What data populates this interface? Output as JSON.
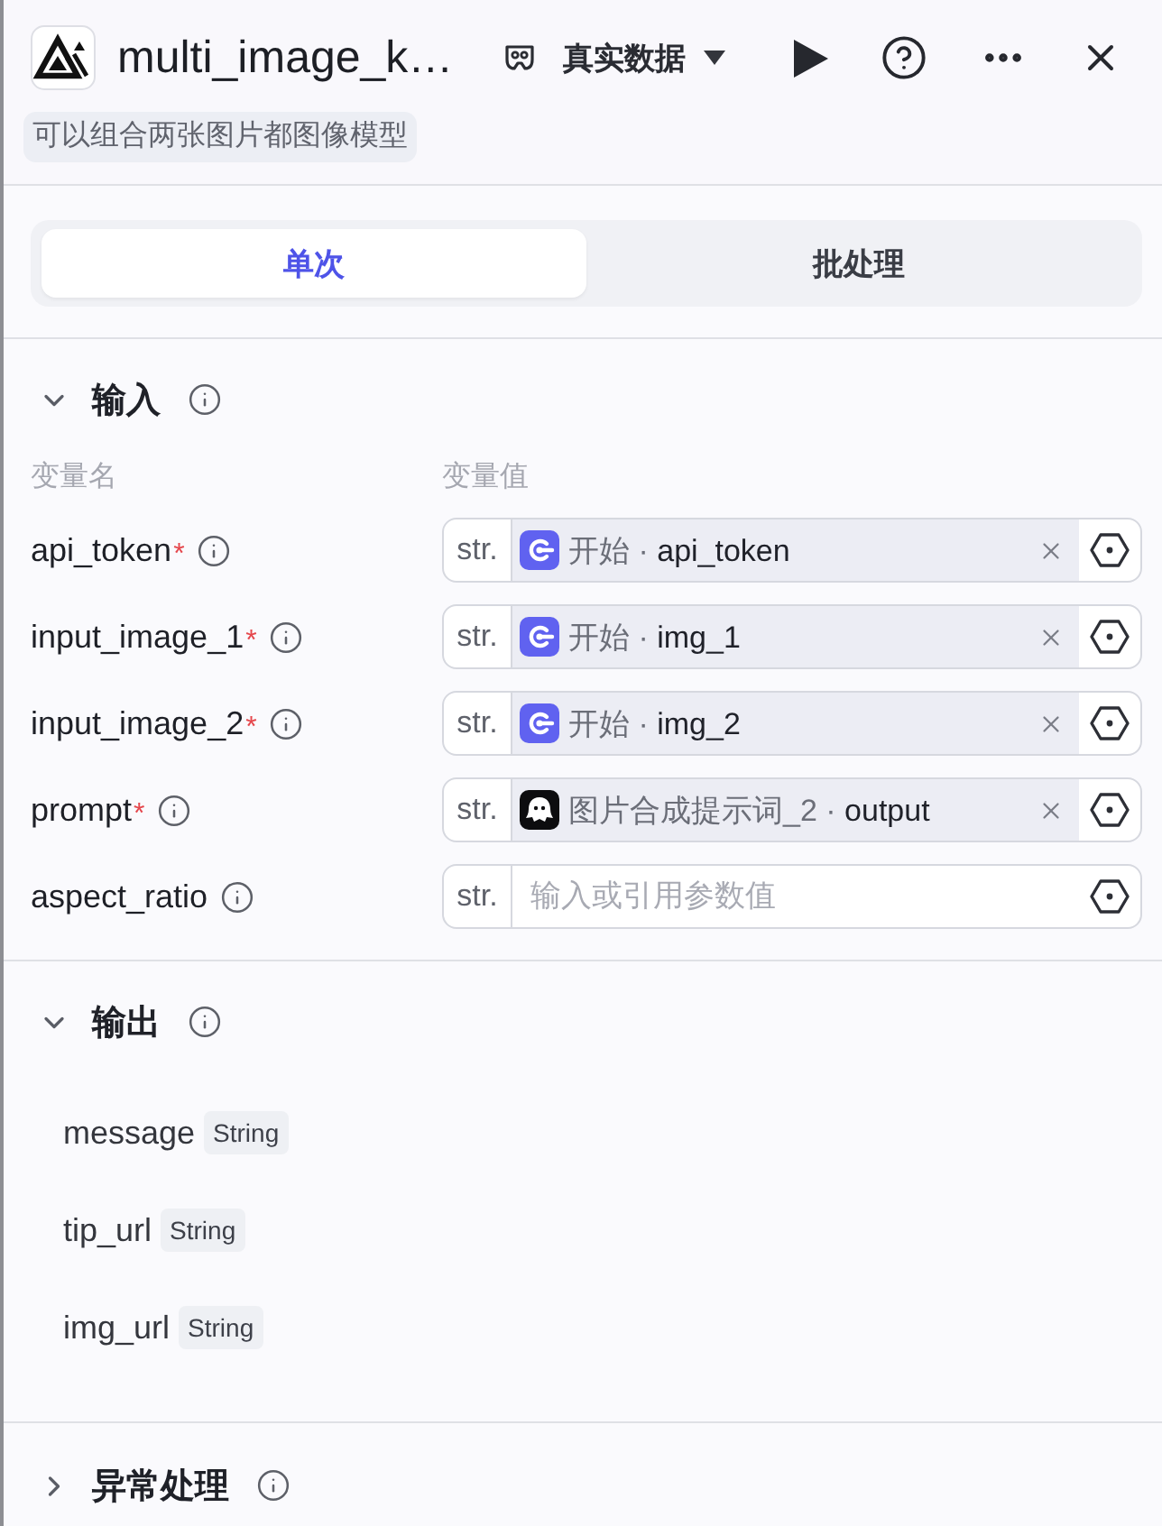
{
  "header": {
    "title": "multi_image_k…",
    "data_mode": "真实数据",
    "description": "可以组合两张图片都图像模型"
  },
  "tabs": [
    {
      "label": "单次",
      "selected": true
    },
    {
      "label": "批处理",
      "selected": false
    }
  ],
  "input_section": {
    "title": "输入",
    "expanded": true,
    "columns": [
      "变量名",
      "变量值"
    ],
    "params": [
      {
        "name": "api_token",
        "required_mark": "*",
        "type": "str.",
        "kind": "reference",
        "reference": {
          "kind": "start",
          "text": "开始 · **api_token**"
        }
      },
      {
        "name": "input_image_1",
        "required_mark": "*",
        "type": "str.",
        "kind": "reference",
        "reference": {
          "kind": "start",
          "text": "开始 · **img_1**"
        }
      },
      {
        "name": "input_image_2",
        "required_mark": "*",
        "type": "str.",
        "kind": "reference",
        "reference": {
          "kind": "start",
          "text": "开始 · **img_2**"
        }
      },
      {
        "name": "prompt",
        "required_mark": "*",
        "type": "str.",
        "kind": "reference",
        "reference": {
          "kind": "node",
          "text": "图片合成提示词_2 · **output**"
        }
      },
      {
        "name": "aspect_ratio",
        "type": "str.",
        "kind": "input",
        "placeholder": "输入或引用参数值"
      }
    ]
  },
  "output_section": {
    "title": "输出",
    "expanded": true,
    "fields": [
      {
        "name": "message",
        "type": "String"
      },
      {
        "name": "tip_url",
        "type": "String"
      },
      {
        "name": "img_url",
        "type": "String"
      }
    ]
  },
  "error_section": {
    "title": "异常处理",
    "expanded": false
  }
}
